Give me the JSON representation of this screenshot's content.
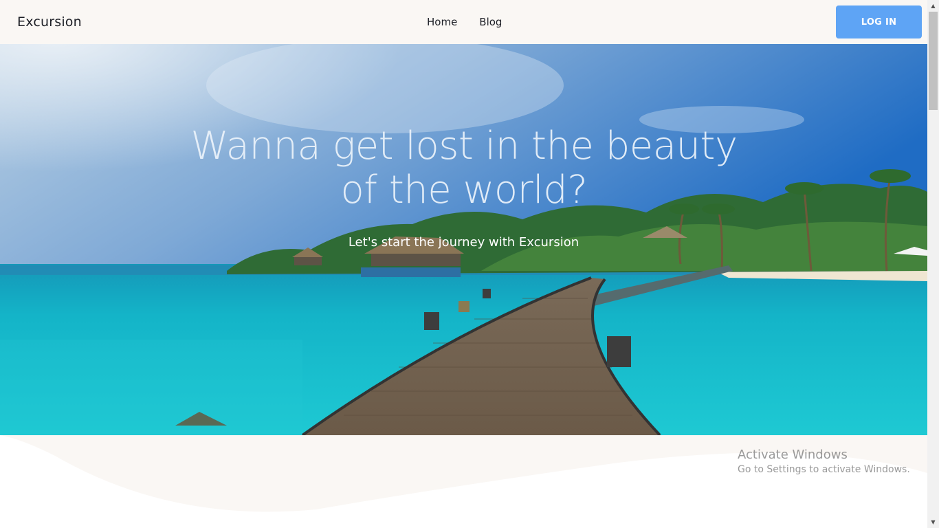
{
  "navbar": {
    "brand": "Excursion",
    "links": [
      {
        "label": "Home"
      },
      {
        "label": "Blog"
      }
    ],
    "login_label": "LOG IN"
  },
  "hero": {
    "title": "Wanna get lost in the beauty of the world?",
    "subtitle": "Let's start the journey with Excursion"
  },
  "watermark": {
    "title": "Activate Windows",
    "subtitle": "Go to Settings to activate Windows."
  },
  "colors": {
    "navbar_bg": "#faf7f4",
    "login_button": "#5ea4f5",
    "wave": "#faf7f4"
  }
}
